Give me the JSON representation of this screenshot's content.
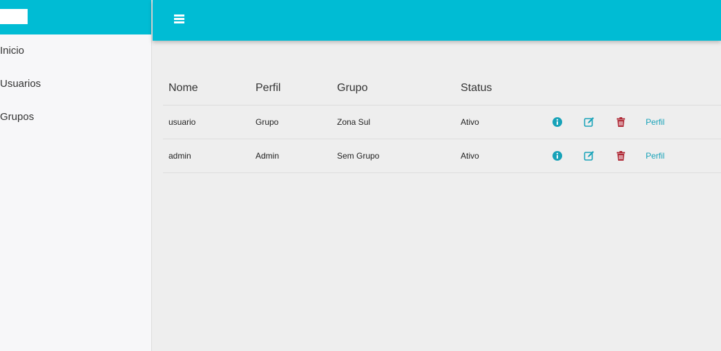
{
  "sidebar": {
    "items": [
      {
        "label": "Inicio"
      },
      {
        "label": "Usuarios"
      },
      {
        "label": "Grupos"
      }
    ]
  },
  "colors": {
    "accent": "#00bcd4",
    "info_icon": "#17a2b8",
    "edit_icon": "#17a2b8",
    "delete_icon": "#b02a37",
    "link": "#17a2b8"
  },
  "topbar": {
    "menu_icon": "hamburger-menu-icon"
  },
  "table": {
    "headers": [
      "Nome",
      "Perfil",
      "Grupo",
      "Status"
    ],
    "rows": [
      {
        "nome": "usuario",
        "perfil": "Grupo",
        "grupo": "Zona Sul",
        "status": "Ativo",
        "action_link": "Perfil"
      },
      {
        "nome": "admin",
        "perfil": "Admin",
        "grupo": "Sem Grupo",
        "status": "Ativo",
        "action_link": "Perfil"
      }
    ],
    "action_icons": [
      "info-icon",
      "edit-icon",
      "trash-icon"
    ]
  }
}
